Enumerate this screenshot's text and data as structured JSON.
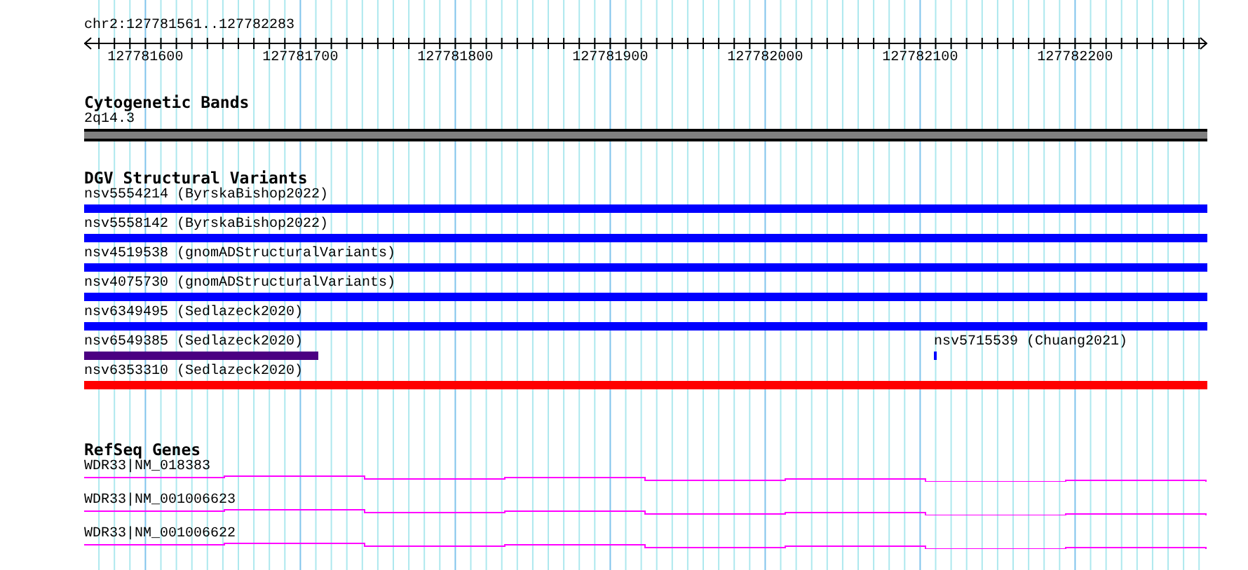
{
  "ruler": {
    "location": "chr2:127781561..127782283",
    "tick_labels": [
      "127781600",
      "127781700",
      "127781800",
      "127781900",
      "127782000",
      "127782100",
      "127782200"
    ]
  },
  "tracks": [
    {
      "kind": "bands",
      "title": "Cytogenetic Bands",
      "rows": [
        {
          "features": [
            {
              "label": "2q14.3",
              "kind": "full",
              "color": "#808080"
            }
          ]
        }
      ]
    },
    {
      "kind": "variants",
      "title": "DGV Structural Variants",
      "rows": [
        {
          "features": [
            {
              "label": "nsv5554214 (ByrskaBishop2022)",
              "kind": "full",
              "color": "#0000ff"
            }
          ]
        },
        {
          "features": [
            {
              "label": "nsv5558142 (ByrskaBishop2022)",
              "kind": "full",
              "color": "#0000ff"
            }
          ]
        },
        {
          "features": [
            {
              "label": "nsv4519538 (gnomADStructuralVariants)",
              "kind": "full",
              "color": "#0000ff"
            }
          ]
        },
        {
          "features": [
            {
              "label": "nsv4075730 (gnomADStructuralVariants)",
              "kind": "full",
              "color": "#0000ff"
            }
          ]
        },
        {
          "features": [
            {
              "label": "nsv6349495 (Sedlazeck2020)",
              "kind": "full",
              "color": "#0000ff"
            }
          ]
        },
        {
          "features": [
            {
              "label": "nsv6549385 (Sedlazeck2020)",
              "kind": "left",
              "color": "#4b0082"
            },
            {
              "label": "nsv5715539 (Chuang2021)",
              "kind": "point",
              "color": "#0000ff"
            }
          ]
        },
        {
          "features": [
            {
              "label": "nsv6353310 (Sedlazeck2020)",
              "kind": "full",
              "color": "#ff0000"
            }
          ]
        }
      ]
    },
    {
      "kind": "genes",
      "title": "RefSeq Genes",
      "rows": [
        {
          "features": [
            {
              "label": "WDR33|NM_018383",
              "color": "#ff00ff"
            }
          ]
        },
        {
          "features": [
            {
              "label": "WDR33|NM_001006623",
              "color": "#ff00ff"
            }
          ]
        },
        {
          "features": [
            {
              "label": "WDR33|NM_001006622",
              "color": "#ff00ff"
            }
          ]
        }
      ]
    }
  ]
}
